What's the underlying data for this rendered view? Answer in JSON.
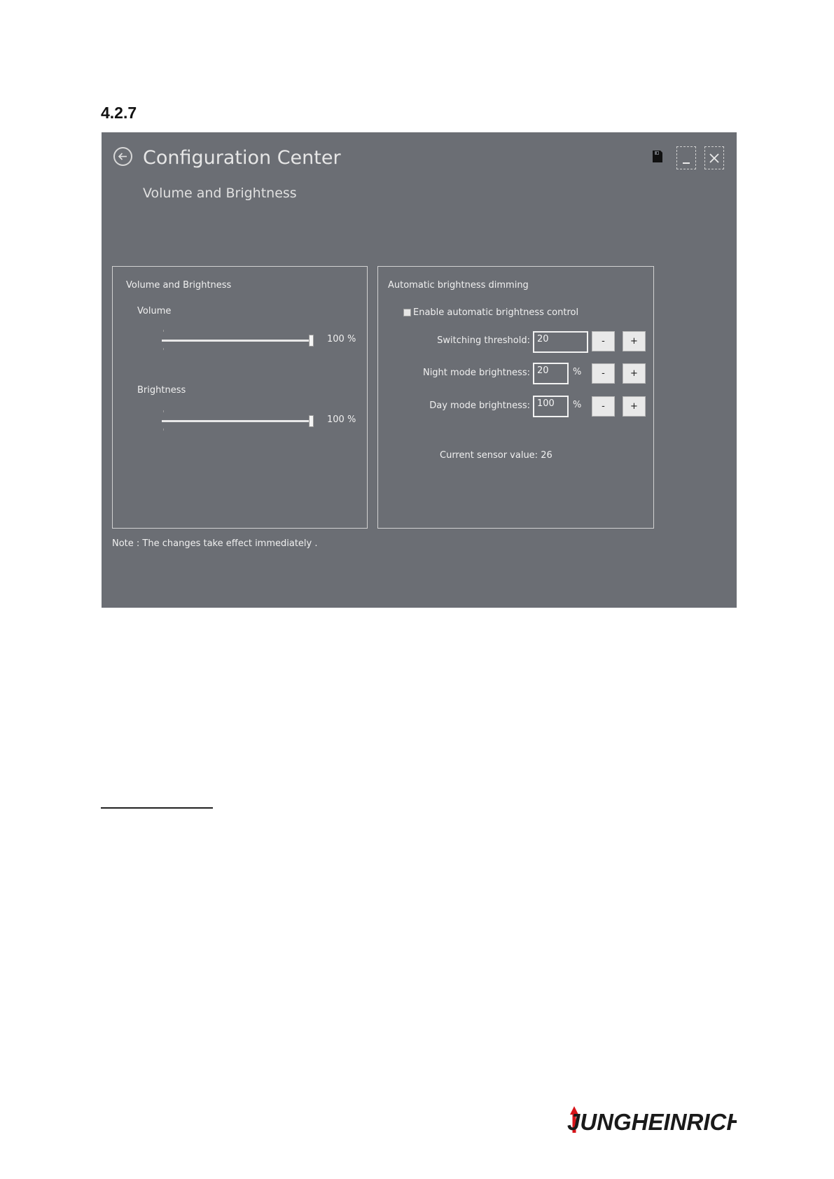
{
  "document": {
    "section_number": "4.2.7",
    "brand": "JUNGHEINRICH"
  },
  "window": {
    "title": "Configuration Center",
    "subtitle": "Volume and Brightness",
    "back_icon": "back-arrow-circle-icon",
    "save_icon": "floppy-disk-icon",
    "minimize_icon": "minimize-icon",
    "close_icon": "close-icon"
  },
  "left_panel": {
    "title": "Volume and Brightness",
    "volume": {
      "label": "Volume",
      "value_label": "100 %",
      "level": 100
    },
    "brightness": {
      "label": "Brightness",
      "value_label": "100 %",
      "level": 100
    }
  },
  "right_panel": {
    "title": "Automatic brightness dimming",
    "auto_checkbox": {
      "label": "Enable automatic brightness control",
      "checked": false
    },
    "switching_threshold": {
      "label": "Switching threshold:",
      "value": "20",
      "minus": "-",
      "plus": "+"
    },
    "night_mode": {
      "label": "Night mode brightness:",
      "value": "20",
      "unit": "%",
      "minus": "-",
      "plus": "+"
    },
    "day_mode": {
      "label": "Day mode brightness:",
      "value": "100",
      "unit": "%",
      "minus": "-",
      "plus": "+"
    },
    "sensor_text": "Current sensor value: 26"
  },
  "note": "Note : The changes take effect immediately .",
  "colors": {
    "window_bg": "#6b6e74",
    "logo_red": "#d7141a",
    "logo_black": "#1a1a1a"
  }
}
